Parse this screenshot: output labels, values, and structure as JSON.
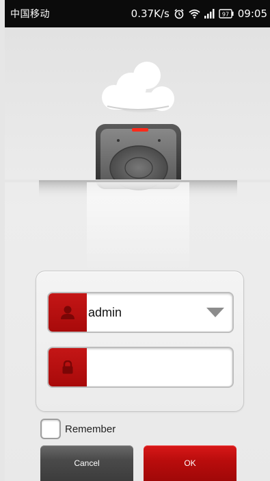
{
  "status_bar": {
    "carrier": "中国移动",
    "speed": "0.37K/s",
    "battery": "97",
    "time": "09:05"
  },
  "login": {
    "username_value": "admin",
    "password_value": "",
    "remember_label": "Remember",
    "remember_checked": false,
    "cancel_label": "Cancel",
    "ok_label": "OK"
  },
  "icons": {
    "user": "user-icon",
    "lock": "lock-icon",
    "dropdown": "triangle-down-icon",
    "alarm": "alarm-icon",
    "wifi": "wifi-icon",
    "signal": "signal-icon",
    "battery": "battery-icon",
    "cloud": "cloud-icon",
    "hard_drive": "hard-drive-icon"
  },
  "colors": {
    "accent_red": "#b80c0c",
    "cancel_gray": "#4a4a4a",
    "status_bar": "#0b0b0b"
  }
}
